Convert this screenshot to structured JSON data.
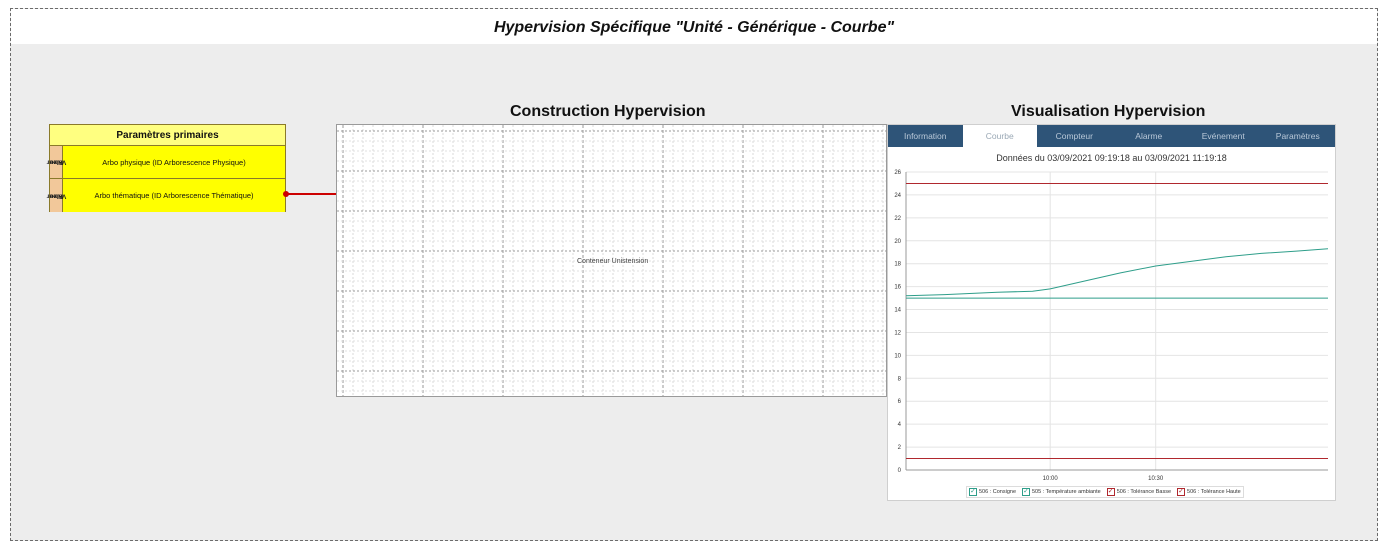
{
  "page": {
    "title": "Hypervision Spécifique \"Unité - Générique - Courbe\""
  },
  "sections": {
    "construction_title": "Construction Hypervision",
    "visualisation_title": "Visualisation Hypervision"
  },
  "params": {
    "header": "Paramètres primaires",
    "rows": [
      {
        "tag_line1": "Valeur",
        "tag_line2": "Fixe",
        "label": "Arbo physique (ID Arborescence Physique)"
      },
      {
        "tag_line1": "Valeur",
        "tag_line2": "Fixe",
        "label": "Arbo thématique (ID Arborescence Thématique)"
      }
    ]
  },
  "construction": {
    "container_label": "Conteneur Unistension"
  },
  "visualisation": {
    "tabs": [
      {
        "label": "Information",
        "active": false
      },
      {
        "label": "Courbe",
        "active": true
      },
      {
        "label": "Compteur",
        "active": false
      },
      {
        "label": "Alarme",
        "active": false
      },
      {
        "label": "Evénement",
        "active": false
      },
      {
        "label": "Paramètres",
        "active": false
      }
    ],
    "header": "Données du 03/09/2021 09:19:18 au 03/09/2021 11:19:18",
    "legend": [
      {
        "label": "506 : Consigne",
        "color": "#2e9e8a"
      },
      {
        "label": "505 : Température ambiante",
        "color": "#2e9e8a"
      },
      {
        "label": "506 : Tolérance Basse",
        "color": "#b0282e"
      },
      {
        "label": "506 : Tolérance Haute",
        "color": "#b0282e"
      }
    ]
  },
  "chart_data": {
    "type": "line",
    "x_ticks": [
      "10:00",
      "10:30"
    ],
    "y_ticks": [
      0,
      2,
      4,
      6,
      8,
      10,
      12,
      14,
      16,
      18,
      20,
      22,
      24,
      26
    ],
    "ylim": [
      0,
      26
    ],
    "xlim": [
      "09:19",
      "11:19"
    ],
    "grid": true,
    "legend_position": "bottom",
    "series": [
      {
        "name": "506 : Consigne",
        "color": "#2e9e8a",
        "constant": 15
      },
      {
        "name": "505 : Température ambiante",
        "color": "#2e9e8a",
        "x": [
          "09:19",
          "09:30",
          "09:45",
          "09:55",
          "10:00",
          "10:10",
          "10:20",
          "10:30",
          "10:40",
          "10:50",
          "11:00",
          "11:10",
          "11:19"
        ],
        "y": [
          15.2,
          15.3,
          15.5,
          15.6,
          15.8,
          16.5,
          17.2,
          17.8,
          18.2,
          18.6,
          18.9,
          19.1,
          19.3
        ]
      },
      {
        "name": "506 : Tolérance Basse",
        "color": "#b0282e",
        "constant": 1
      },
      {
        "name": "506 : Tolérance Haute",
        "color": "#b0282e",
        "constant": 25
      }
    ]
  }
}
